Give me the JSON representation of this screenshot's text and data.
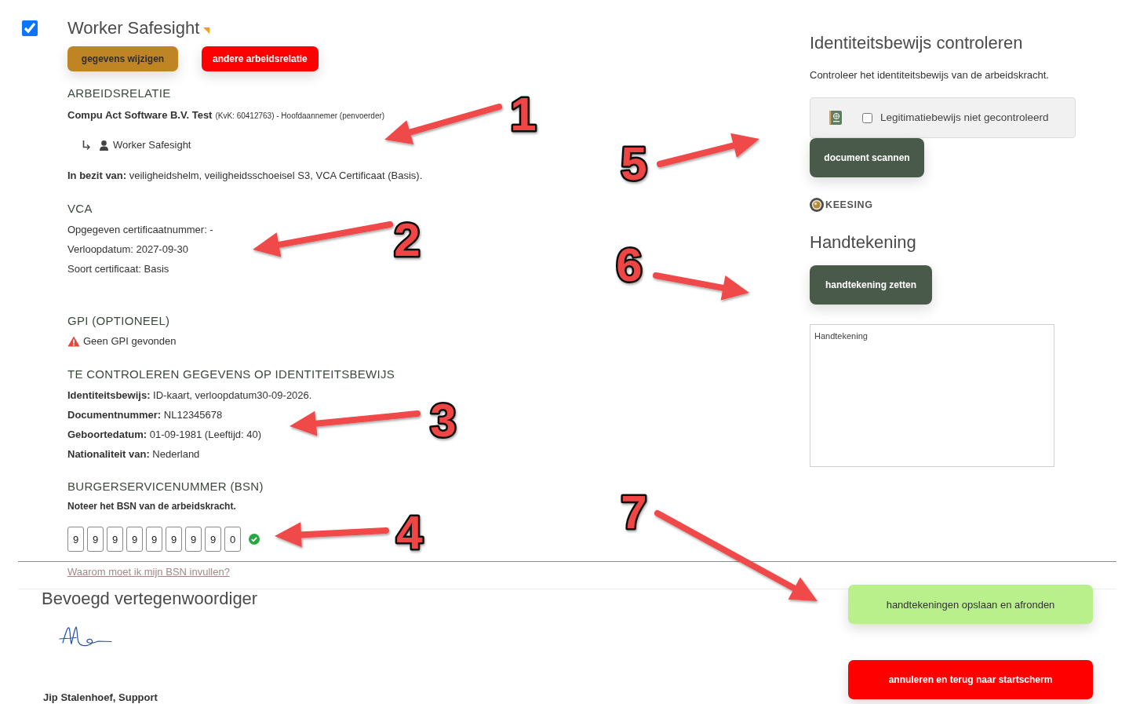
{
  "worker": {
    "checked": true,
    "name": "Worker Safesight"
  },
  "actions": [
    {
      "label": "gegevens wijzigen",
      "kind": "edit"
    },
    {
      "label": "andere arbeidsrelatie",
      "kind": "danger"
    }
  ],
  "employment": {
    "heading": "ARBEIDSRELATIE",
    "company": "Compu Act Software B.V. Test",
    "company_details": "(KvK: 60412763) - Hoofdaannemer (penvoerder)",
    "worker": "Worker Safesight",
    "possession": "**In bezit van:** veiligheidshelm, veiligheidsschoeisel S3, VCA Certificaat (Basis)."
  },
  "vca": {
    "heading": "VCA",
    "lines": [
      "Opgegeven certificaatnummer: -",
      "Verloopdatum: 2027-09-30",
      "Soort certificaat: Basis"
    ]
  },
  "gpi": {
    "heading": "GPI (OPTIONEEL)",
    "message": "Geen GPI gevonden"
  },
  "id_check": {
    "heading": "TE CONTROLEREN GEGEVENS OP IDENTITEITSBEWIJS",
    "lines": [
      "**Identiteitsbewijs:** ID-kaart, verloopdatum30-09-2026.",
      "**Documentnummer:** NL12345678",
      "**Geboortedatum:** 01-09-1981 (Leeftijd: 40)",
      "**Nationaliteit van:** Nederland"
    ]
  },
  "bsn": {
    "heading": "BURGERSERVICENUMMER (BSN)",
    "instruction": "Noteer het BSN van de arbeidskracht.",
    "digits": [
      "9",
      "9",
      "9",
      "9",
      "9",
      "9",
      "9",
      "9",
      "0"
    ],
    "valid": true,
    "help_link": "Waarom moet ik mijn BSN invullen?"
  },
  "identity": {
    "heading": "Identiteitsbewijs controleren",
    "description": "Controleer het identiteitsbewijs van de arbeidskracht.",
    "checkbox": {
      "label": "Legitimatiebewijs niet gecontroleerd",
      "checked": false
    },
    "scan_button": {
      "label": "document scannen",
      "kind": "primary"
    },
    "logo": "KEESING"
  },
  "signature": {
    "heading": "Handtekening",
    "button": {
      "label": "handtekening zetten",
      "kind": "primary"
    },
    "pad_label": "Handtekening"
  },
  "representative": {
    "heading": "Bevoegd vertegenwoordiger",
    "name": "Jip Stalenhoef, Support"
  },
  "footer_buttons": [
    {
      "label": "handtekeningen opslaan en afronden",
      "kind": "confirm"
    },
    {
      "label": "annuleren en terug naar startscherm",
      "kind": "cancel"
    }
  ],
  "annotations": [
    {
      "label": "1"
    },
    {
      "label": "2"
    },
    {
      "label": "3"
    },
    {
      "label": "4"
    },
    {
      "label": "5"
    },
    {
      "label": "6"
    },
    {
      "label": "7"
    }
  ]
}
